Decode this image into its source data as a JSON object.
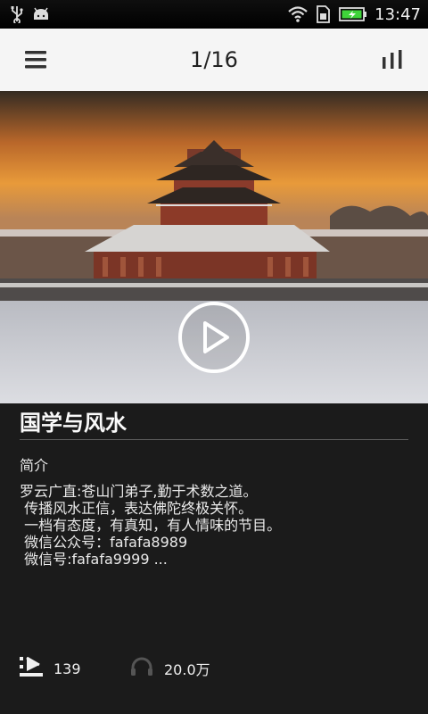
{
  "status_bar": {
    "time": "13:47",
    "icons": [
      "usb-icon",
      "android-icon",
      "wifi-icon",
      "sim-icon",
      "battery-charging-icon"
    ]
  },
  "header": {
    "menu_icon": "menu-icon",
    "page_indicator": "1/16",
    "chart_icon": "bar-chart-icon"
  },
  "cover": {
    "play_icon": "play-icon"
  },
  "album": {
    "title": "国学与风水",
    "section_label": "简介",
    "description_lines": [
      "罗云广直:苍山门弟子,勤于术数之道。",
      " 传播风水正信，表达佛陀终极关怀。",
      " 一档有态度，有真知，有人情味的节目。",
      " 微信公众号：fafafa8989",
      " 微信号:fafafa9999 ..."
    ]
  },
  "stats": {
    "episodes": "139",
    "episodes_icon": "playlist-icon",
    "plays": "20.0万",
    "plays_icon": "headphones-icon"
  },
  "colors": {
    "header_bg": "#f5f5f5",
    "content_bg": "#1b1b1b",
    "text": "#f2f2f2"
  }
}
